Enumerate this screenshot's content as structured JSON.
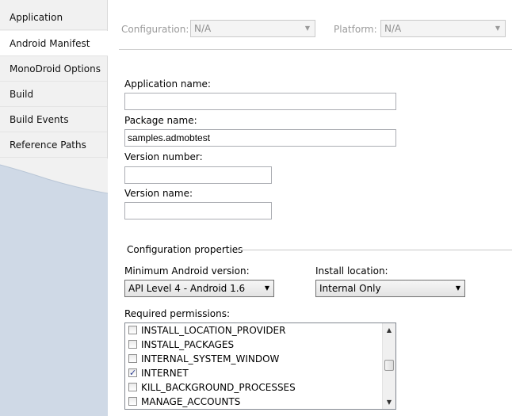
{
  "sidebar": {
    "items": [
      {
        "label": "Application",
        "selected": false
      },
      {
        "label": "Android Manifest",
        "selected": true
      },
      {
        "label": "MonoDroid Options",
        "selected": false
      },
      {
        "label": "Build",
        "selected": false
      },
      {
        "label": "Build Events",
        "selected": false
      },
      {
        "label": "Reference Paths",
        "selected": false
      }
    ]
  },
  "topbar": {
    "configuration_label": "Configuration:",
    "configuration_value": "N/A",
    "platform_label": "Platform:",
    "platform_value": "N/A"
  },
  "form": {
    "application_name_label": "Application name:",
    "application_name_value": "",
    "package_name_label": "Package name:",
    "package_name_value": "samples.admobtest",
    "version_number_label": "Version number:",
    "version_number_value": "",
    "version_name_label": "Version name:",
    "version_name_value": ""
  },
  "config_props": {
    "group_label": "Configuration properties",
    "min_version_label": "Minimum Android version:",
    "min_version_value": "API Level 4 - Android 1.6",
    "install_location_label": "Install location:",
    "install_location_value": "Internal Only",
    "permissions_label": "Required permissions:",
    "permissions": [
      {
        "name": "INSTALL_LOCATION_PROVIDER",
        "checked": false
      },
      {
        "name": "INSTALL_PACKAGES",
        "checked": false
      },
      {
        "name": "INTERNAL_SYSTEM_WINDOW",
        "checked": false
      },
      {
        "name": "INTERNET",
        "checked": true
      },
      {
        "name": "KILL_BACKGROUND_PROCESSES",
        "checked": false
      },
      {
        "name": "MANAGE_ACCOUNTS",
        "checked": false
      }
    ]
  },
  "colors": {
    "sidebar_blue": "#cfd9e6",
    "selected_tab": "#ffffff",
    "check_mark": "#2a3b8f"
  }
}
